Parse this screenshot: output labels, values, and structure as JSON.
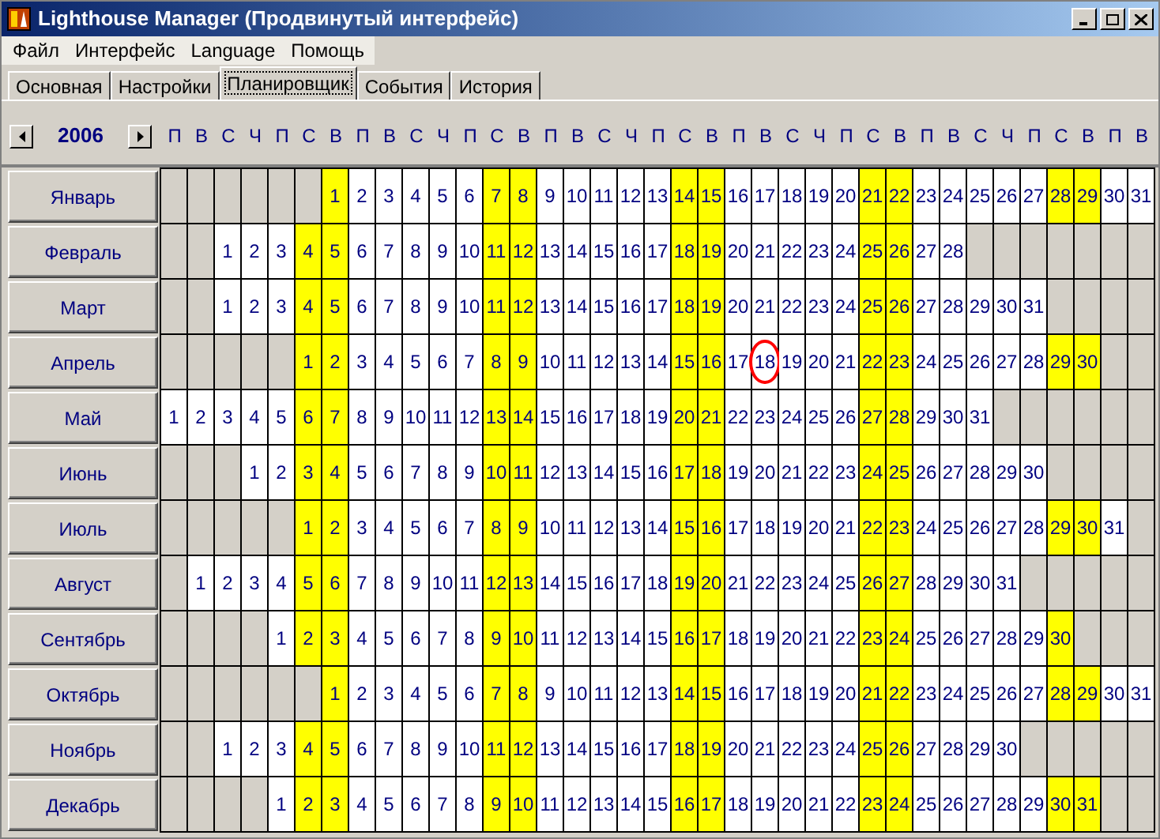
{
  "window": {
    "title": "Lighthouse Manager (Продвинутый интерфейс)"
  },
  "menu": [
    "Файл",
    "Интерфейс",
    "Language",
    "Помощь"
  ],
  "tabs": [
    {
      "label": "Основная",
      "selected": false
    },
    {
      "label": "Настройки",
      "selected": false
    },
    {
      "label": "Планировщик",
      "selected": true
    },
    {
      "label": "События",
      "selected": false
    },
    {
      "label": "История",
      "selected": false
    }
  ],
  "year": "2006",
  "weekdays": [
    {
      "label": "П",
      "weekend": false
    },
    {
      "label": "В",
      "weekend": false
    },
    {
      "label": "С",
      "weekend": false
    },
    {
      "label": "Ч",
      "weekend": false
    },
    {
      "label": "П",
      "weekend": false
    },
    {
      "label": "С",
      "weekend": true
    },
    {
      "label": "В",
      "weekend": true
    },
    {
      "label": "П",
      "weekend": false
    },
    {
      "label": "В",
      "weekend": false
    },
    {
      "label": "С",
      "weekend": false
    },
    {
      "label": "Ч",
      "weekend": false
    },
    {
      "label": "П",
      "weekend": false
    },
    {
      "label": "С",
      "weekend": true
    },
    {
      "label": "В",
      "weekend": true
    },
    {
      "label": "П",
      "weekend": false
    },
    {
      "label": "В",
      "weekend": false
    },
    {
      "label": "С",
      "weekend": false
    },
    {
      "label": "Ч",
      "weekend": false
    },
    {
      "label": "П",
      "weekend": false
    },
    {
      "label": "С",
      "weekend": true
    },
    {
      "label": "В",
      "weekend": true
    },
    {
      "label": "П",
      "weekend": false
    },
    {
      "label": "В",
      "weekend": false
    },
    {
      "label": "С",
      "weekend": false
    },
    {
      "label": "Ч",
      "weekend": false
    },
    {
      "label": "П",
      "weekend": false
    },
    {
      "label": "С",
      "weekend": true
    },
    {
      "label": "В",
      "weekend": true
    },
    {
      "label": "П",
      "weekend": false
    },
    {
      "label": "В",
      "weekend": false
    },
    {
      "label": "С",
      "weekend": false
    },
    {
      "label": "Ч",
      "weekend": false
    },
    {
      "label": "П",
      "weekend": false
    },
    {
      "label": "С",
      "weekend": true
    },
    {
      "label": "В",
      "weekend": true
    },
    {
      "label": "П",
      "weekend": false
    },
    {
      "label": "В",
      "weekend": false
    }
  ],
  "months": [
    {
      "name": "Январь",
      "cells": [
        null,
        null,
        null,
        null,
        null,
        null,
        {
          "day": "1",
          "circled": false
        },
        {
          "day": "2",
          "circled": false
        },
        {
          "day": "3",
          "circled": false
        },
        {
          "day": "4",
          "circled": false
        },
        {
          "day": "5",
          "circled": false
        },
        {
          "day": "6",
          "circled": false
        },
        {
          "day": "7",
          "circled": false
        },
        {
          "day": "8",
          "circled": false
        },
        {
          "day": "9",
          "circled": false
        },
        {
          "day": "10",
          "circled": false
        },
        {
          "day": "11",
          "circled": false
        },
        {
          "day": "12",
          "circled": false
        },
        {
          "day": "13",
          "circled": false
        },
        {
          "day": "14",
          "circled": false
        },
        {
          "day": "15",
          "circled": false
        },
        {
          "day": "16",
          "circled": false
        },
        {
          "day": "17",
          "circled": false
        },
        {
          "day": "18",
          "circled": false
        },
        {
          "day": "19",
          "circled": false
        },
        {
          "day": "20",
          "circled": false
        },
        {
          "day": "21",
          "circled": false
        },
        {
          "day": "22",
          "circled": false
        },
        {
          "day": "23",
          "circled": false
        },
        {
          "day": "24",
          "circled": false
        },
        {
          "day": "25",
          "circled": false
        },
        {
          "day": "26",
          "circled": false
        },
        {
          "day": "27",
          "circled": false
        },
        {
          "day": "28",
          "circled": false
        },
        {
          "day": "29",
          "circled": false
        },
        {
          "day": "30",
          "circled": false
        },
        {
          "day": "31",
          "circled": false
        }
      ]
    },
    {
      "name": "Февраль",
      "cells": [
        null,
        null,
        {
          "day": "1",
          "circled": false
        },
        {
          "day": "2",
          "circled": false
        },
        {
          "day": "3",
          "circled": false
        },
        {
          "day": "4",
          "circled": false
        },
        {
          "day": "5",
          "circled": false
        },
        {
          "day": "6",
          "circled": false
        },
        {
          "day": "7",
          "circled": false
        },
        {
          "day": "8",
          "circled": false
        },
        {
          "day": "9",
          "circled": false
        },
        {
          "day": "10",
          "circled": false
        },
        {
          "day": "11",
          "circled": false
        },
        {
          "day": "12",
          "circled": false
        },
        {
          "day": "13",
          "circled": false
        },
        {
          "day": "14",
          "circled": false
        },
        {
          "day": "15",
          "circled": false
        },
        {
          "day": "16",
          "circled": false
        },
        {
          "day": "17",
          "circled": false
        },
        {
          "day": "18",
          "circled": false
        },
        {
          "day": "19",
          "circled": false
        },
        {
          "day": "20",
          "circled": false
        },
        {
          "day": "21",
          "circled": false
        },
        {
          "day": "22",
          "circled": false
        },
        {
          "day": "23",
          "circled": false
        },
        {
          "day": "24",
          "circled": false
        },
        {
          "day": "25",
          "circled": false
        },
        {
          "day": "26",
          "circled": false
        },
        {
          "day": "27",
          "circled": false
        },
        {
          "day": "28",
          "circled": false
        },
        null,
        null,
        null,
        null,
        null,
        null,
        null
      ]
    },
    {
      "name": "Март",
      "cells": [
        null,
        null,
        {
          "day": "1",
          "circled": false
        },
        {
          "day": "2",
          "circled": false
        },
        {
          "day": "3",
          "circled": false
        },
        {
          "day": "4",
          "circled": false
        },
        {
          "day": "5",
          "circled": false
        },
        {
          "day": "6",
          "circled": false
        },
        {
          "day": "7",
          "circled": false
        },
        {
          "day": "8",
          "circled": false
        },
        {
          "day": "9",
          "circled": false
        },
        {
          "day": "10",
          "circled": false
        },
        {
          "day": "11",
          "circled": false
        },
        {
          "day": "12",
          "circled": false
        },
        {
          "day": "13",
          "circled": false
        },
        {
          "day": "14",
          "circled": false
        },
        {
          "day": "15",
          "circled": false
        },
        {
          "day": "16",
          "circled": false
        },
        {
          "day": "17",
          "circled": false
        },
        {
          "day": "18",
          "circled": false
        },
        {
          "day": "19",
          "circled": false
        },
        {
          "day": "20",
          "circled": false
        },
        {
          "day": "21",
          "circled": false
        },
        {
          "day": "22",
          "circled": false
        },
        {
          "day": "23",
          "circled": false
        },
        {
          "day": "24",
          "circled": false
        },
        {
          "day": "25",
          "circled": false
        },
        {
          "day": "26",
          "circled": false
        },
        {
          "day": "27",
          "circled": false
        },
        {
          "day": "28",
          "circled": false
        },
        {
          "day": "29",
          "circled": false
        },
        {
          "day": "30",
          "circled": false
        },
        {
          "day": "31",
          "circled": false
        },
        null,
        null,
        null,
        null
      ]
    },
    {
      "name": "Апрель",
      "cells": [
        null,
        null,
        null,
        null,
        null,
        {
          "day": "1",
          "circled": false
        },
        {
          "day": "2",
          "circled": false
        },
        {
          "day": "3",
          "circled": false
        },
        {
          "day": "4",
          "circled": false
        },
        {
          "day": "5",
          "circled": false
        },
        {
          "day": "6",
          "circled": false
        },
        {
          "day": "7",
          "circled": false
        },
        {
          "day": "8",
          "circled": false
        },
        {
          "day": "9",
          "circled": false
        },
        {
          "day": "10",
          "circled": false
        },
        {
          "day": "11",
          "circled": false
        },
        {
          "day": "12",
          "circled": false
        },
        {
          "day": "13",
          "circled": false
        },
        {
          "day": "14",
          "circled": false
        },
        {
          "day": "15",
          "circled": false
        },
        {
          "day": "16",
          "circled": false
        },
        {
          "day": "17",
          "circled": false
        },
        {
          "day": "18",
          "circled": true
        },
        {
          "day": "19",
          "circled": false
        },
        {
          "day": "20",
          "circled": false
        },
        {
          "day": "21",
          "circled": false
        },
        {
          "day": "22",
          "circled": false
        },
        {
          "day": "23",
          "circled": false
        },
        {
          "day": "24",
          "circled": false
        },
        {
          "day": "25",
          "circled": false
        },
        {
          "day": "26",
          "circled": false
        },
        {
          "day": "27",
          "circled": false
        },
        {
          "day": "28",
          "circled": false
        },
        {
          "day": "29",
          "circled": false
        },
        {
          "day": "30",
          "circled": false
        },
        null,
        null
      ]
    },
    {
      "name": "Май",
      "cells": [
        {
          "day": "1",
          "circled": false
        },
        {
          "day": "2",
          "circled": false
        },
        {
          "day": "3",
          "circled": false
        },
        {
          "day": "4",
          "circled": false
        },
        {
          "day": "5",
          "circled": false
        },
        {
          "day": "6",
          "circled": false
        },
        {
          "day": "7",
          "circled": false
        },
        {
          "day": "8",
          "circled": false
        },
        {
          "day": "9",
          "circled": false
        },
        {
          "day": "10",
          "circled": false
        },
        {
          "day": "11",
          "circled": false
        },
        {
          "day": "12",
          "circled": false
        },
        {
          "day": "13",
          "circled": false
        },
        {
          "day": "14",
          "circled": false
        },
        {
          "day": "15",
          "circled": false
        },
        {
          "day": "16",
          "circled": false
        },
        {
          "day": "17",
          "circled": false
        },
        {
          "day": "18",
          "circled": false
        },
        {
          "day": "19",
          "circled": false
        },
        {
          "day": "20",
          "circled": false
        },
        {
          "day": "21",
          "circled": false
        },
        {
          "day": "22",
          "circled": false
        },
        {
          "day": "23",
          "circled": false
        },
        {
          "day": "24",
          "circled": false
        },
        {
          "day": "25",
          "circled": false
        },
        {
          "day": "26",
          "circled": false
        },
        {
          "day": "27",
          "circled": false
        },
        {
          "day": "28",
          "circled": false
        },
        {
          "day": "29",
          "circled": false
        },
        {
          "day": "30",
          "circled": false
        },
        {
          "day": "31",
          "circled": false
        },
        null,
        null,
        null,
        null,
        null,
        null
      ]
    },
    {
      "name": "Июнь",
      "cells": [
        null,
        null,
        null,
        {
          "day": "1",
          "circled": false
        },
        {
          "day": "2",
          "circled": false
        },
        {
          "day": "3",
          "circled": false
        },
        {
          "day": "4",
          "circled": false
        },
        {
          "day": "5",
          "circled": false
        },
        {
          "day": "6",
          "circled": false
        },
        {
          "day": "7",
          "circled": false
        },
        {
          "day": "8",
          "circled": false
        },
        {
          "day": "9",
          "circled": false
        },
        {
          "day": "10",
          "circled": false
        },
        {
          "day": "11",
          "circled": false
        },
        {
          "day": "12",
          "circled": false
        },
        {
          "day": "13",
          "circled": false
        },
        {
          "day": "14",
          "circled": false
        },
        {
          "day": "15",
          "circled": false
        },
        {
          "day": "16",
          "circled": false
        },
        {
          "day": "17",
          "circled": false
        },
        {
          "day": "18",
          "circled": false
        },
        {
          "day": "19",
          "circled": false
        },
        {
          "day": "20",
          "circled": false
        },
        {
          "day": "21",
          "circled": false
        },
        {
          "day": "22",
          "circled": false
        },
        {
          "day": "23",
          "circled": false
        },
        {
          "day": "24",
          "circled": false
        },
        {
          "day": "25",
          "circled": false
        },
        {
          "day": "26",
          "circled": false
        },
        {
          "day": "27",
          "circled": false
        },
        {
          "day": "28",
          "circled": false
        },
        {
          "day": "29",
          "circled": false
        },
        {
          "day": "30",
          "circled": false
        },
        null,
        null,
        null,
        null
      ]
    },
    {
      "name": "Июль",
      "cells": [
        null,
        null,
        null,
        null,
        null,
        {
          "day": "1",
          "circled": false
        },
        {
          "day": "2",
          "circled": false
        },
        {
          "day": "3",
          "circled": false
        },
        {
          "day": "4",
          "circled": false
        },
        {
          "day": "5",
          "circled": false
        },
        {
          "day": "6",
          "circled": false
        },
        {
          "day": "7",
          "circled": false
        },
        {
          "day": "8",
          "circled": false
        },
        {
          "day": "9",
          "circled": false
        },
        {
          "day": "10",
          "circled": false
        },
        {
          "day": "11",
          "circled": false
        },
        {
          "day": "12",
          "circled": false
        },
        {
          "day": "13",
          "circled": false
        },
        {
          "day": "14",
          "circled": false
        },
        {
          "day": "15",
          "circled": false
        },
        {
          "day": "16",
          "circled": false
        },
        {
          "day": "17",
          "circled": false
        },
        {
          "day": "18",
          "circled": false
        },
        {
          "day": "19",
          "circled": false
        },
        {
          "day": "20",
          "circled": false
        },
        {
          "day": "21",
          "circled": false
        },
        {
          "day": "22",
          "circled": false
        },
        {
          "day": "23",
          "circled": false
        },
        {
          "day": "24",
          "circled": false
        },
        {
          "day": "25",
          "circled": false
        },
        {
          "day": "26",
          "circled": false
        },
        {
          "day": "27",
          "circled": false
        },
        {
          "day": "28",
          "circled": false
        },
        {
          "day": "29",
          "circled": false
        },
        {
          "day": "30",
          "circled": false
        },
        {
          "day": "31",
          "circled": false
        },
        null
      ]
    },
    {
      "name": "Август",
      "cells": [
        null,
        {
          "day": "1",
          "circled": false
        },
        {
          "day": "2",
          "circled": false
        },
        {
          "day": "3",
          "circled": false
        },
        {
          "day": "4",
          "circled": false
        },
        {
          "day": "5",
          "circled": false
        },
        {
          "day": "6",
          "circled": false
        },
        {
          "day": "7",
          "circled": false
        },
        {
          "day": "8",
          "circled": false
        },
        {
          "day": "9",
          "circled": false
        },
        {
          "day": "10",
          "circled": false
        },
        {
          "day": "11",
          "circled": false
        },
        {
          "day": "12",
          "circled": false
        },
        {
          "day": "13",
          "circled": false
        },
        {
          "day": "14",
          "circled": false
        },
        {
          "day": "15",
          "circled": false
        },
        {
          "day": "16",
          "circled": false
        },
        {
          "day": "17",
          "circled": false
        },
        {
          "day": "18",
          "circled": false
        },
        {
          "day": "19",
          "circled": false
        },
        {
          "day": "20",
          "circled": false
        },
        {
          "day": "21",
          "circled": false
        },
        {
          "day": "22",
          "circled": false
        },
        {
          "day": "23",
          "circled": false
        },
        {
          "day": "24",
          "circled": false
        },
        {
          "day": "25",
          "circled": false
        },
        {
          "day": "26",
          "circled": false
        },
        {
          "day": "27",
          "circled": false
        },
        {
          "day": "28",
          "circled": false
        },
        {
          "day": "29",
          "circled": false
        },
        {
          "day": "30",
          "circled": false
        },
        {
          "day": "31",
          "circled": false
        },
        null,
        null,
        null,
        null,
        null
      ]
    },
    {
      "name": "Сентябрь",
      "cells": [
        null,
        null,
        null,
        null,
        {
          "day": "1",
          "circled": false
        },
        {
          "day": "2",
          "circled": false
        },
        {
          "day": "3",
          "circled": false
        },
        {
          "day": "4",
          "circled": false
        },
        {
          "day": "5",
          "circled": false
        },
        {
          "day": "6",
          "circled": false
        },
        {
          "day": "7",
          "circled": false
        },
        {
          "day": "8",
          "circled": false
        },
        {
          "day": "9",
          "circled": false
        },
        {
          "day": "10",
          "circled": false
        },
        {
          "day": "11",
          "circled": false
        },
        {
          "day": "12",
          "circled": false
        },
        {
          "day": "13",
          "circled": false
        },
        {
          "day": "14",
          "circled": false
        },
        {
          "day": "15",
          "circled": false
        },
        {
          "day": "16",
          "circled": false
        },
        {
          "day": "17",
          "circled": false
        },
        {
          "day": "18",
          "circled": false
        },
        {
          "day": "19",
          "circled": false
        },
        {
          "day": "20",
          "circled": false
        },
        {
          "day": "21",
          "circled": false
        },
        {
          "day": "22",
          "circled": false
        },
        {
          "day": "23",
          "circled": false
        },
        {
          "day": "24",
          "circled": false
        },
        {
          "day": "25",
          "circled": false
        },
        {
          "day": "26",
          "circled": false
        },
        {
          "day": "27",
          "circled": false
        },
        {
          "day": "28",
          "circled": false
        },
        {
          "day": "29",
          "circled": false
        },
        {
          "day": "30",
          "circled": false
        },
        null,
        null,
        null
      ]
    },
    {
      "name": "Октябрь",
      "cells": [
        null,
        null,
        null,
        null,
        null,
        null,
        {
          "day": "1",
          "circled": false
        },
        {
          "day": "2",
          "circled": false
        },
        {
          "day": "3",
          "circled": false
        },
        {
          "day": "4",
          "circled": false
        },
        {
          "day": "5",
          "circled": false
        },
        {
          "day": "6",
          "circled": false
        },
        {
          "day": "7",
          "circled": false
        },
        {
          "day": "8",
          "circled": false
        },
        {
          "day": "9",
          "circled": false
        },
        {
          "day": "10",
          "circled": false
        },
        {
          "day": "11",
          "circled": false
        },
        {
          "day": "12",
          "circled": false
        },
        {
          "day": "13",
          "circled": false
        },
        {
          "day": "14",
          "circled": false
        },
        {
          "day": "15",
          "circled": false
        },
        {
          "day": "16",
          "circled": false
        },
        {
          "day": "17",
          "circled": false
        },
        {
          "day": "18",
          "circled": false
        },
        {
          "day": "19",
          "circled": false
        },
        {
          "day": "20",
          "circled": false
        },
        {
          "day": "21",
          "circled": false
        },
        {
          "day": "22",
          "circled": false
        },
        {
          "day": "23",
          "circled": false
        },
        {
          "day": "24",
          "circled": false
        },
        {
          "day": "25",
          "circled": false
        },
        {
          "day": "26",
          "circled": false
        },
        {
          "day": "27",
          "circled": false
        },
        {
          "day": "28",
          "circled": false
        },
        {
          "day": "29",
          "circled": false
        },
        {
          "day": "30",
          "circled": false
        },
        {
          "day": "31",
          "circled": false
        }
      ]
    },
    {
      "name": "Ноябрь",
      "cells": [
        null,
        null,
        {
          "day": "1",
          "circled": false
        },
        {
          "day": "2",
          "circled": false
        },
        {
          "day": "3",
          "circled": false
        },
        {
          "day": "4",
          "circled": false
        },
        {
          "day": "5",
          "circled": false
        },
        {
          "day": "6",
          "circled": false
        },
        {
          "day": "7",
          "circled": false
        },
        {
          "day": "8",
          "circled": false
        },
        {
          "day": "9",
          "circled": false
        },
        {
          "day": "10",
          "circled": false
        },
        {
          "day": "11",
          "circled": false
        },
        {
          "day": "12",
          "circled": false
        },
        {
          "day": "13",
          "circled": false
        },
        {
          "day": "14",
          "circled": false
        },
        {
          "day": "15",
          "circled": false
        },
        {
          "day": "16",
          "circled": false
        },
        {
          "day": "17",
          "circled": false
        },
        {
          "day": "18",
          "circled": false
        },
        {
          "day": "19",
          "circled": false
        },
        {
          "day": "20",
          "circled": false
        },
        {
          "day": "21",
          "circled": false
        },
        {
          "day": "22",
          "circled": false
        },
        {
          "day": "23",
          "circled": false
        },
        {
          "day": "24",
          "circled": false
        },
        {
          "day": "25",
          "circled": false
        },
        {
          "day": "26",
          "circled": false
        },
        {
          "day": "27",
          "circled": false
        },
        {
          "day": "28",
          "circled": false
        },
        {
          "day": "29",
          "circled": false
        },
        {
          "day": "30",
          "circled": false
        },
        null,
        null,
        null,
        null,
        null
      ]
    },
    {
      "name": "Декабрь",
      "cells": [
        null,
        null,
        null,
        null,
        {
          "day": "1",
          "circled": false
        },
        {
          "day": "2",
          "circled": false
        },
        {
          "day": "3",
          "circled": false
        },
        {
          "day": "4",
          "circled": false
        },
        {
          "day": "5",
          "circled": false
        },
        {
          "day": "6",
          "circled": false
        },
        {
          "day": "7",
          "circled": false
        },
        {
          "day": "8",
          "circled": false
        },
        {
          "day": "9",
          "circled": false
        },
        {
          "day": "10",
          "circled": false
        },
        {
          "day": "11",
          "circled": false
        },
        {
          "day": "12",
          "circled": false
        },
        {
          "day": "13",
          "circled": false
        },
        {
          "day": "14",
          "circled": false
        },
        {
          "day": "15",
          "circled": false
        },
        {
          "day": "16",
          "circled": false
        },
        {
          "day": "17",
          "circled": false
        },
        {
          "day": "18",
          "circled": false
        },
        {
          "day": "19",
          "circled": false
        },
        {
          "day": "20",
          "circled": false
        },
        {
          "day": "21",
          "circled": false
        },
        {
          "day": "22",
          "circled": false
        },
        {
          "day": "23",
          "circled": false
        },
        {
          "day": "24",
          "circled": false
        },
        {
          "day": "25",
          "circled": false
        },
        {
          "day": "26",
          "circled": false
        },
        {
          "day": "27",
          "circled": false
        },
        {
          "day": "28",
          "circled": false
        },
        {
          "day": "29",
          "circled": false
        },
        {
          "day": "30",
          "circled": false
        },
        {
          "day": "31",
          "circled": false
        },
        null,
        null
      ]
    }
  ]
}
